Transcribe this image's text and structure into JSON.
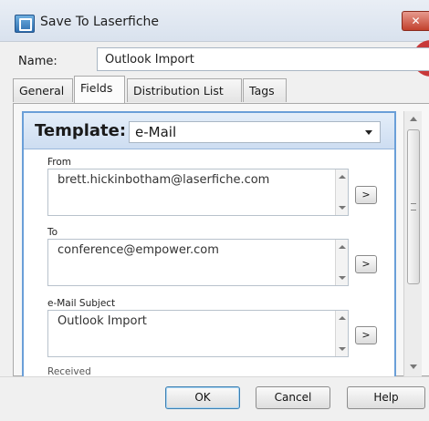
{
  "window": {
    "title": "Save To Laserfiche",
    "close_label": "✕"
  },
  "name": {
    "label": "Name:",
    "value": "Outlook Import"
  },
  "tabs": [
    {
      "label": "General"
    },
    {
      "label": "Fields",
      "active": true
    },
    {
      "label": "Distribution List"
    },
    {
      "label": "Tags"
    }
  ],
  "template": {
    "label": "Template:",
    "value": "e-Mail"
  },
  "fields": [
    {
      "label": "From",
      "value": "brett.hickinbotham@laserfiche.com",
      "button": ">"
    },
    {
      "label": "To",
      "value": "conference@empower.com",
      "button": ">"
    },
    {
      "label": "e-Mail Subject",
      "value": "Outlook Import",
      "button": ">"
    }
  ],
  "next_field_partial": "Received",
  "buttons": {
    "ok": "OK",
    "cancel": "Cancel",
    "help": "Help"
  },
  "colors": {
    "accent": "#6a9fd8",
    "close": "#c2412d",
    "badge": "#c8393a"
  }
}
